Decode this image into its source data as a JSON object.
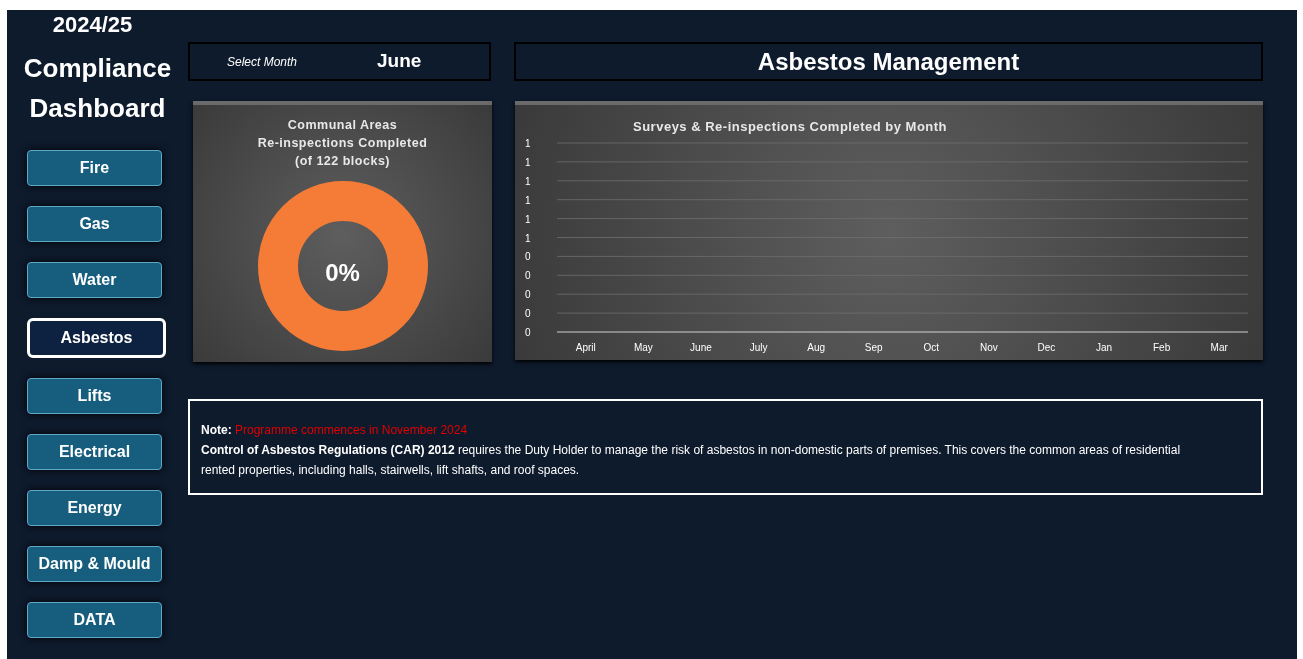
{
  "sidebar": {
    "year": "2024/25",
    "title": "Compliance Dashboard",
    "items": [
      {
        "label": "Fire",
        "selected": false
      },
      {
        "label": "Gas",
        "selected": false
      },
      {
        "label": "Water",
        "selected": false
      },
      {
        "label": "Asbestos",
        "selected": true
      },
      {
        "label": "Lifts",
        "selected": false
      },
      {
        "label": "Electrical",
        "selected": false
      },
      {
        "label": "Energy",
        "selected": false
      },
      {
        "label": "Damp & Mould",
        "selected": false
      },
      {
        "label": "DATA",
        "selected": false
      }
    ]
  },
  "month_selector": {
    "label": "Select Month",
    "value": "June"
  },
  "header": {
    "title": "Asbestos Management"
  },
  "donut_panel": {
    "title_lines": [
      "Communal Areas",
      "Re-inspections Completed",
      "(of 122 blocks)"
    ],
    "value": "0%"
  },
  "chart_panel": {
    "chart_data": {
      "type": "bar",
      "title": "Surveys & Re-inspections Completed by Month",
      "categories": [
        "April",
        "May",
        "June",
        "July",
        "Aug",
        "Sep",
        "Oct",
        "Nov",
        "Dec",
        "Jan",
        "Feb",
        "Mar"
      ],
      "values": [
        0,
        0,
        0,
        0,
        0,
        0,
        0,
        0,
        0,
        0,
        0,
        0
      ],
      "grid": true,
      "ylim": [
        0,
        1
      ],
      "yticks": [
        {
          "value": 0,
          "label": "0"
        },
        {
          "value": 0.1,
          "label": "0"
        },
        {
          "value": 0.2,
          "label": "0"
        },
        {
          "value": 0.3,
          "label": "0"
        },
        {
          "value": 0.4,
          "label": "0"
        },
        {
          "value": 0.5,
          "label": "1"
        },
        {
          "value": 0.6,
          "label": "1"
        },
        {
          "value": 0.7,
          "label": "1"
        },
        {
          "value": 0.8,
          "label": "1"
        },
        {
          "value": 0.9,
          "label": "1"
        },
        {
          "value": 1,
          "label": "1"
        }
      ]
    }
  },
  "note": {
    "label": "Note:",
    "highlight": "Programme commences in November 2024",
    "body": "**Control of Asbestos Regulations (CAR) 2012** requires the Duty Holder to manage the risk of asbestos in non-domestic parts of premises. This covers the common areas of residential rented properties, including halls, stairwells, lift shafts, and roof spaces."
  }
}
